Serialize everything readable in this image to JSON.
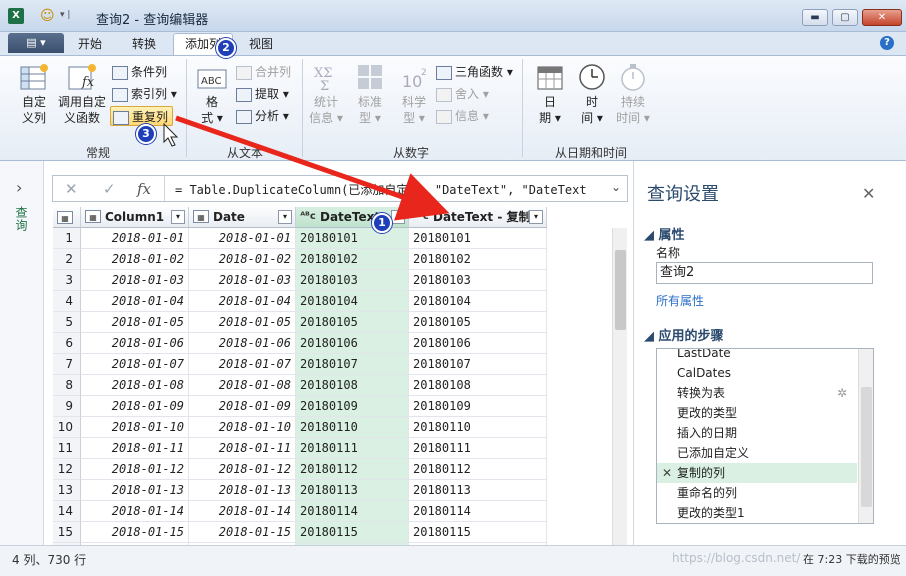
{
  "window": {
    "title": "查询2 - 查询编辑器",
    "app_icon": "X",
    "minimize": "▬",
    "maximize": "▢",
    "close": "✕"
  },
  "ribbon_tabs": {
    "file_label": "▤ ▾",
    "tabs": [
      "开始",
      "转换",
      "添加列",
      "视图"
    ],
    "active_tab": "添加列"
  },
  "ribbon": {
    "general": {
      "label": "常规",
      "custom_column": [
        "自定",
        "义列"
      ],
      "invoke_function": [
        "调用自定",
        "义函数"
      ],
      "conditional_column": "条件列",
      "index_column": "索引列 ▾",
      "duplicate_column": "重复列"
    },
    "from_text": {
      "label": "从文本",
      "format": [
        "格",
        "式 ▾"
      ],
      "merge_columns": "合并列",
      "extract": "提取 ▾",
      "parse": "分析 ▾"
    },
    "from_number": {
      "label": "从数字",
      "statistics": [
        "统计",
        "信息 ▾"
      ],
      "standard": [
        "标准",
        "型 ▾"
      ],
      "scientific": [
        "科学",
        "型 ▾"
      ],
      "trigonometry": "三角函数 ▾",
      "rounding": "舍入 ▾",
      "information": "信息 ▾"
    },
    "from_datetime": {
      "label": "从日期和时间",
      "date": [
        "日",
        "期 ▾"
      ],
      "time": [
        "时",
        "间 ▾"
      ],
      "duration": [
        "持续",
        "时间 ▾"
      ]
    }
  },
  "nav": {
    "label": "查询"
  },
  "formula_bar": {
    "cancel": "✕",
    "commit": "✓",
    "fx": "fx",
    "text": "= Table.DuplicateColumn(已添加自定义, \"DateText\", \"DateText - 复"
  },
  "grid": {
    "columns": [
      {
        "name": "Column1",
        "type": "table-icon"
      },
      {
        "name": "Date",
        "type": "date-icon"
      },
      {
        "name": "DateText",
        "type": "text-icon",
        "selected": true
      },
      {
        "name": "DateText - 复制",
        "type": "text-icon"
      }
    ],
    "rows": [
      {
        "n": "1",
        "c1": "2018-01-01",
        "c2": "2018-01-01",
        "c3": "20180101",
        "c4": "20180101"
      },
      {
        "n": "2",
        "c1": "2018-01-02",
        "c2": "2018-01-02",
        "c3": "20180102",
        "c4": "20180102"
      },
      {
        "n": "3",
        "c1": "2018-01-03",
        "c2": "2018-01-03",
        "c3": "20180103",
        "c4": "20180103"
      },
      {
        "n": "4",
        "c1": "2018-01-04",
        "c2": "2018-01-04",
        "c3": "20180104",
        "c4": "20180104"
      },
      {
        "n": "5",
        "c1": "2018-01-05",
        "c2": "2018-01-05",
        "c3": "20180105",
        "c4": "20180105"
      },
      {
        "n": "6",
        "c1": "2018-01-06",
        "c2": "2018-01-06",
        "c3": "20180106",
        "c4": "20180106"
      },
      {
        "n": "7",
        "c1": "2018-01-07",
        "c2": "2018-01-07",
        "c3": "20180107",
        "c4": "20180107"
      },
      {
        "n": "8",
        "c1": "2018-01-08",
        "c2": "2018-01-08",
        "c3": "20180108",
        "c4": "20180108"
      },
      {
        "n": "9",
        "c1": "2018-01-09",
        "c2": "2018-01-09",
        "c3": "20180109",
        "c4": "20180109"
      },
      {
        "n": "10",
        "c1": "2018-01-10",
        "c2": "2018-01-10",
        "c3": "20180110",
        "c4": "20180110"
      },
      {
        "n": "11",
        "c1": "2018-01-11",
        "c2": "2018-01-11",
        "c3": "20180111",
        "c4": "20180111"
      },
      {
        "n": "12",
        "c1": "2018-01-12",
        "c2": "2018-01-12",
        "c3": "20180112",
        "c4": "20180112"
      },
      {
        "n": "13",
        "c1": "2018-01-13",
        "c2": "2018-01-13",
        "c3": "20180113",
        "c4": "20180113"
      },
      {
        "n": "14",
        "c1": "2018-01-14",
        "c2": "2018-01-14",
        "c3": "20180114",
        "c4": "20180114"
      },
      {
        "n": "15",
        "c1": "2018-01-15",
        "c2": "2018-01-15",
        "c3": "20180115",
        "c4": "20180115"
      }
    ]
  },
  "settings": {
    "title": "查询设置",
    "close": "✕",
    "properties_header": "属性",
    "name_label": "名称",
    "name_value": "查询2",
    "all_properties": "所有属性",
    "steps_header": "应用的步骤",
    "steps": [
      "LastDate",
      "CalDates",
      "转换为表",
      "更改的类型",
      "插入的日期",
      "已添加自定义",
      "复制的列",
      "重命名的列",
      "更改的类型1"
    ],
    "current_step": "复制的列"
  },
  "status": {
    "left": "4 列、730 行",
    "right": "在 7:23 下载的预览",
    "watermark": "https://blog.csdn.net/"
  },
  "annotations": {
    "badge1": "1",
    "badge2": "2",
    "badge3": "3",
    "arrow_color": "#e8261c",
    "badge_color": "#1f3fb8"
  },
  "colors": {
    "selected_column": "#d9f0e2",
    "accent_blue": "#2a6fc7",
    "excel_green": "#1e7145"
  }
}
